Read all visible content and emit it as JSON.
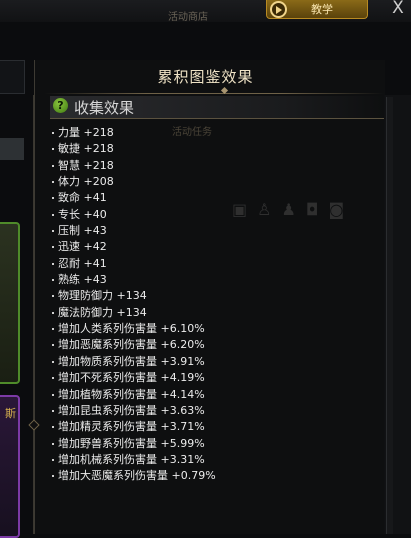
{
  "background": {
    "top_label": "活动商店",
    "mid_label": "活动任务",
    "left_card_text": "斯"
  },
  "topbar": {
    "teach_label": "教学",
    "close_label": "X"
  },
  "panel": {
    "title": "累积图鉴效果",
    "section_title": "收集效果",
    "help_label": "?"
  },
  "stats": [
    "力量 +218",
    "敏捷 +218",
    "智慧 +218",
    "体力 +208",
    "致命 +41",
    "专长 +40",
    "压制 +43",
    "迅速 +42",
    "忍耐 +41",
    "熟练 +43",
    "物理防御力 +134",
    "魔法防御力 +134",
    "增加人类系列伤害量 +6.10%",
    "增加恶魔系列伤害量 +6.20%",
    "增加物质系列伤害量 +3.91%",
    "增加不死系列伤害量 +4.19%",
    "增加植物系列伤害量 +4.14%",
    "增加昆虫系列伤害量 +3.63%",
    "增加精灵系列伤害量 +3.71%",
    "增加野兽系列伤害量 +5.99%",
    "增加机械系列伤害量 +3.31%",
    "增加大恶魔系列伤害量 +0.79%"
  ]
}
